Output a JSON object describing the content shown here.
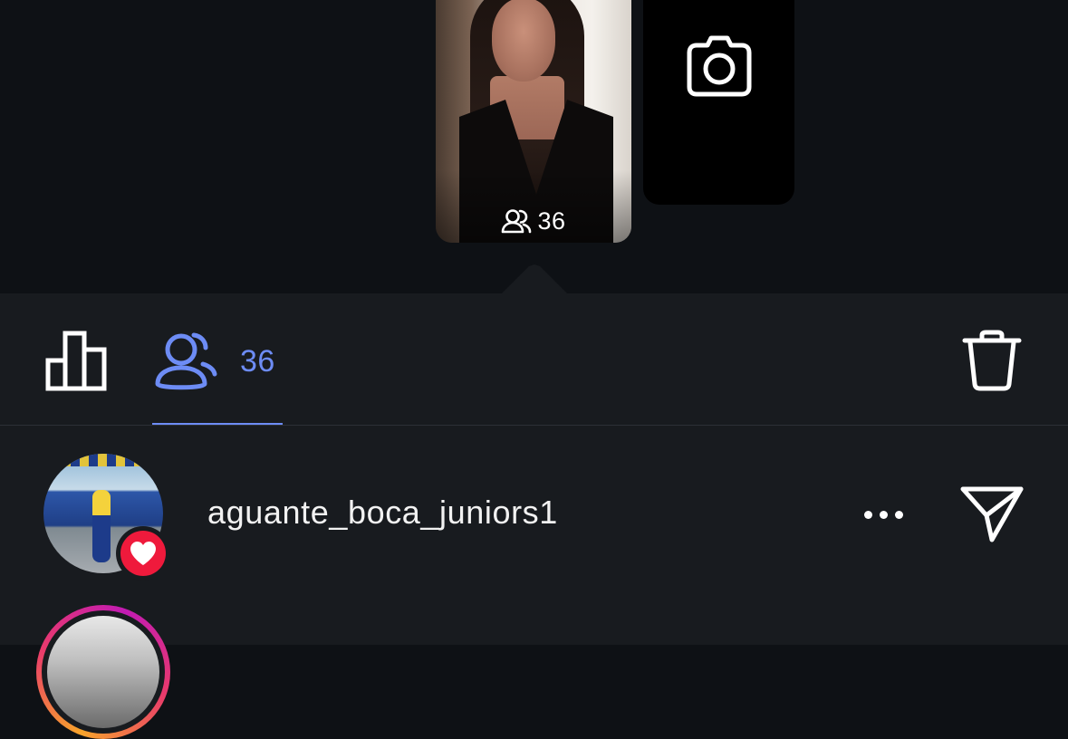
{
  "story": {
    "viewer_count": "36"
  },
  "tabs": {
    "viewers_count": "36",
    "accent_color": "#6d8cf5"
  },
  "viewers": [
    {
      "username": "aguante_boca_juniors1",
      "reaction": "heart-icon",
      "reaction_color": "#ef1a3c"
    }
  ],
  "icons": {
    "viewers": "people-icon",
    "insights": "bar-chart-icon",
    "delete": "trash-icon",
    "camera": "camera-icon",
    "more": "more-icon",
    "send": "send-icon"
  }
}
